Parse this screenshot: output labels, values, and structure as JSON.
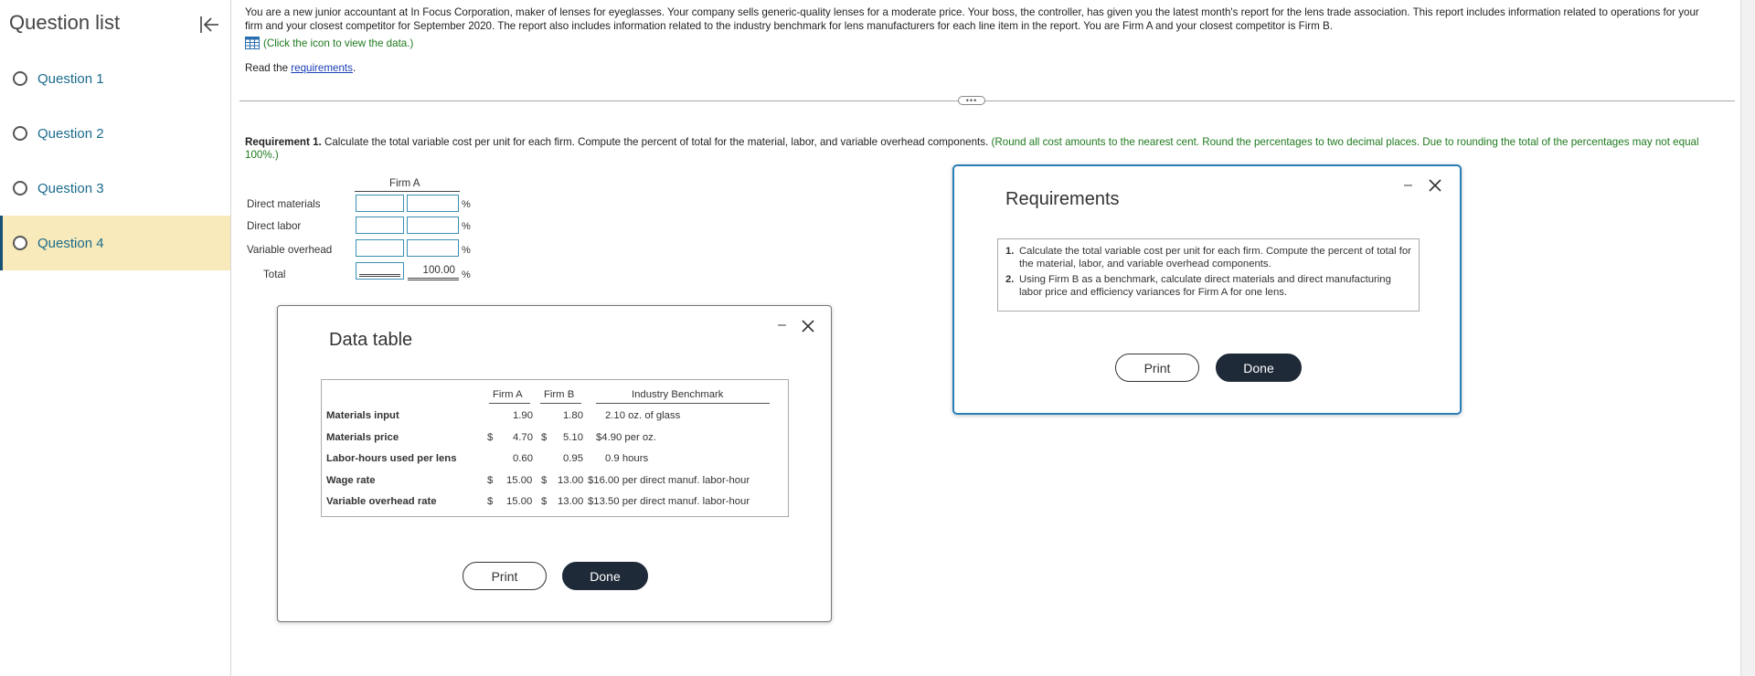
{
  "sidebar": {
    "title": "Question list",
    "items": [
      {
        "label": "Question 1",
        "active": false
      },
      {
        "label": "Question 2",
        "active": false
      },
      {
        "label": "Question 3",
        "active": false
      },
      {
        "label": "Question 4",
        "active": true
      }
    ]
  },
  "intro": {
    "text": "You are a new junior accountant at In Focus Corporation, maker of lenses for eyeglasses. Your company sells generic-quality lenses for a moderate price. Your boss, the controller, has given you the latest month's report for the lens trade association. This report includes information related to operations for your firm and your closest competitor for September 2020. The report also includes information related to the industry benchmark for lens manufacturers for each line item in the report. You are Firm A and your closest competitor is Firm B.",
    "data_link": "(Click the icon to view the data.)",
    "read_prefix": "Read the ",
    "read_link": "requirements",
    "read_suffix": "."
  },
  "requirement1": {
    "label": "Requirement 1.",
    "text": " Calculate the total variable cost per unit for each firm. Compute the percent of total for the material, labor, and variable overhead components.",
    "note": " (Round all cost amounts to the nearest cent. Round the percentages to two decimal places. Due to rounding the total of the percentages may not equal 100%.)"
  },
  "answer_grid": {
    "header": "Firm A",
    "rows": [
      "Direct materials",
      "Direct labor",
      "Variable overhead",
      "Total"
    ],
    "percent_sign": "%",
    "total_percent": "100.00"
  },
  "data_table": {
    "title": "Data table",
    "columns": [
      "Firm A",
      "Firm B",
      "Industry Benchmark"
    ],
    "rows": [
      {
        "label": "Materials input",
        "a_sym": "",
        "a": "1.90",
        "b_sym": "",
        "b": "1.80",
        "bench": "2.10 oz. of glass"
      },
      {
        "label": "Materials price",
        "a_sym": "$",
        "a": "4.70",
        "b_sym": "$",
        "b": "5.10",
        "bench": "$4.90 per oz."
      },
      {
        "label": "Labor-hours used per lens",
        "a_sym": "",
        "a": "0.60",
        "b_sym": "",
        "b": "0.95",
        "bench": "0.9 hours"
      },
      {
        "label": "Wage rate",
        "a_sym": "$",
        "a": "15.00",
        "b_sym": "$",
        "b": "13.00",
        "bench": "$16.00 per direct manuf. labor-hour"
      },
      {
        "label": "Variable overhead rate",
        "a_sym": "$",
        "a": "15.00",
        "b_sym": "$",
        "b": "13.00",
        "bench": "$13.50 per direct manuf. labor-hour"
      }
    ],
    "print_label": "Print",
    "done_label": "Done"
  },
  "requirements_dialog": {
    "title": "Requirements",
    "items": [
      {
        "num": "1.",
        "text": "Calculate the total variable cost per unit for each firm. Compute the percent of total for the material, labor, and variable overhead components."
      },
      {
        "num": "2.",
        "text": "Using Firm B as a benchmark, calculate direct materials and direct manufacturing labor price and efficiency variances for Firm A for one lens."
      }
    ],
    "print_label": "Print",
    "done_label": "Done"
  },
  "colors": {
    "accent_link": "#1c6b8c",
    "active_bg": "#f8eaba",
    "hint_green": "#1e7a1e",
    "input_border": "#3a8fb3",
    "button_dark": "#1f2a38",
    "dialog_focus": "#2a7fb8"
  },
  "dialog_controls": {
    "minimize": "–"
  }
}
